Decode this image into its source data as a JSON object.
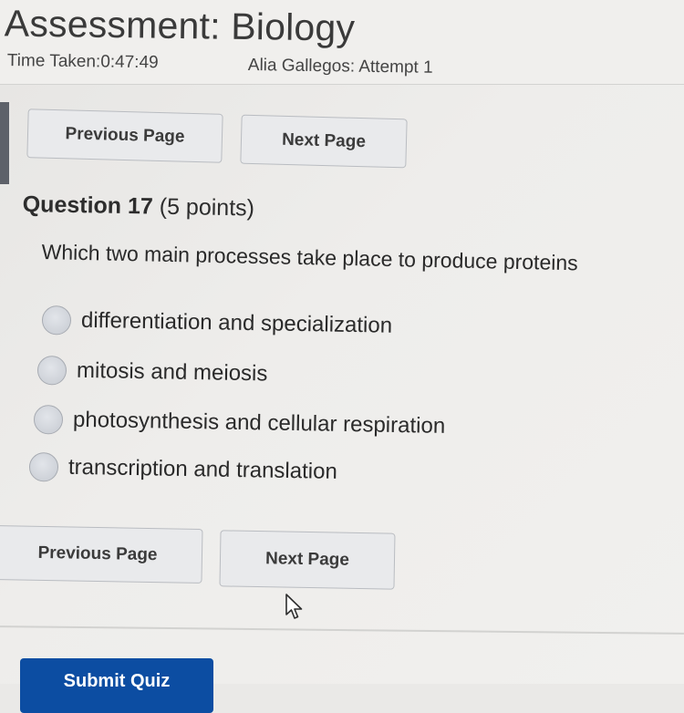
{
  "header": {
    "title": "r Assessment: Biology",
    "time_taken": "Time Taken:0:47:49",
    "attempt": "Alia Gallegos: Attempt 1"
  },
  "nav": {
    "previous_label": "Previous Page",
    "next_label": "Next Page"
  },
  "question": {
    "number_label": "Question 17",
    "points_label": "(5 points)",
    "text": "Which two main processes take place to produce proteins",
    "options": [
      {
        "label": "differentiation and specialization",
        "selected": false
      },
      {
        "label": "mitosis and meiosis",
        "selected": false
      },
      {
        "label": "photosynthesis and cellular respiration",
        "selected": false
      },
      {
        "label": "transcription and translation",
        "selected": false
      }
    ]
  },
  "footer": {
    "submit_label": "Submit Quiz"
  },
  "colors": {
    "submit_button": "#0c4da2",
    "page_background": "#eeedeb",
    "nav_button": "#e9eaec"
  },
  "icons": {
    "cursor": "mouse-pointer-icon",
    "radio": "radio-button"
  }
}
